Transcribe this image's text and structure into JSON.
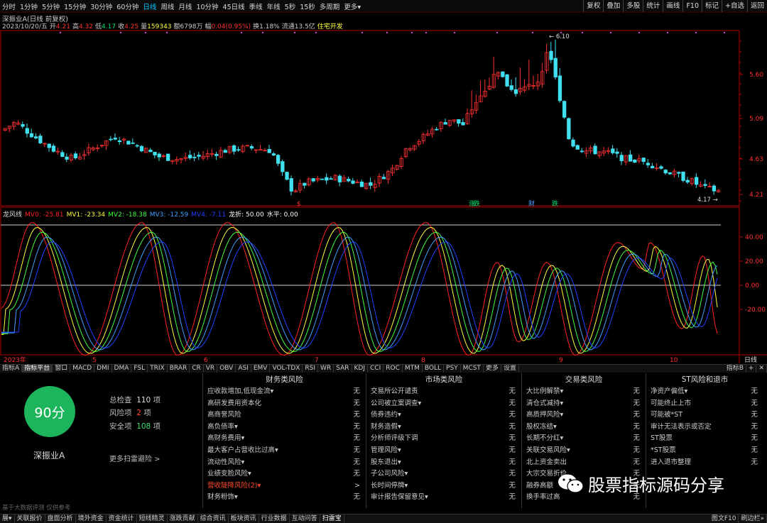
{
  "toolbar": {
    "periods": [
      "分时",
      "1分钟",
      "5分钟",
      "15分钟",
      "30分钟",
      "60分钟",
      "日线",
      "周线",
      "月线",
      "10分钟",
      "45日线",
      "季线",
      "年线",
      "5秒",
      "15秒",
      "多周期",
      "更多▾"
    ],
    "tools": [
      "复权",
      "叠加",
      "多股",
      "统计",
      "画线",
      "F10",
      "标记",
      "+自选",
      "返回"
    ]
  },
  "stock": {
    "title": "深振业A(日线 前复权)",
    "date": "2023/10/20/五",
    "open_label": "开",
    "open": "4.21",
    "high_label": "高",
    "high": "4.32",
    "low_label": "低",
    "low": "4.17",
    "close_label": "收",
    "close": "4.25",
    "volume_label": "量",
    "volume": "159343",
    "amount_label": "额",
    "amount": "6798万",
    "change_label": "幅",
    "change": "0.04(0.95%)",
    "turnover_label": "换",
    "turnover": "1.18%",
    "float_label": "流通",
    "float": "13.5亿",
    "sector": "住宅开发"
  },
  "price_axis": [
    "5.60",
    "5.09",
    "4.63",
    "4.21"
  ],
  "price_marks": {
    "high": "6.10",
    "low": "4.17"
  },
  "event_tags": [
    {
      "text": "$",
      "color": "#ff3030"
    },
    {
      "text": "涨",
      "color": "#00e070"
    },
    {
      "text": "跌",
      "color": "#00e070"
    },
    {
      "text": "财",
      "color": "#4aa0ff"
    },
    {
      "text": "跌",
      "color": "#00e070"
    }
  ],
  "indicator": {
    "name": "龙风线",
    "legend": [
      {
        "text": "MV0: -25.81",
        "color": "#ff2020"
      },
      {
        "text": "MV1: -23.34",
        "color": "#ffff40"
      },
      {
        "text": "MV2: -18.38",
        "color": "#40ff40"
      },
      {
        "text": "MV3: -12.59",
        "color": "#40a0ff"
      },
      {
        "text": "MV4: -7.11",
        "color": "#2040ff"
      },
      {
        "text": "龙折: 50.00",
        "color": "#ffffff"
      },
      {
        "text": "水平: 0.00",
        "color": "#ffffff"
      }
    ],
    "axis": [
      "40.00",
      "20.00",
      "0.00",
      "-20.00"
    ],
    "level": 50,
    "zero": 0
  },
  "time_axis": [
    "2023年",
    "5",
    "6",
    "7",
    "8",
    "9",
    "10"
  ],
  "time_axis_right": "日线",
  "indicator_tabs": [
    "指标A",
    "指标平台",
    "窗口",
    "MACD",
    "DMI",
    "DMA",
    "FSL",
    "TRIX",
    "BRAR",
    "CR",
    "VR",
    "OBV",
    "ASI",
    "EMV",
    "VOL-TDX",
    "RSI",
    "WR",
    "SAR",
    "KDJ",
    "CCI",
    "ROC",
    "MTM",
    "BOLL",
    "PSY",
    "MCST",
    "更多",
    "设置"
  ],
  "indicator_tabs_right": [
    "指标B",
    "+",
    "✕"
  ],
  "risk": {
    "score": "90分",
    "stock_name": "深振业A",
    "total_label": "总检查",
    "total": "110",
    "risk_label": "风险项",
    "risk_count": "2",
    "safe_label": "安全项",
    "safe_count": "108",
    "unit": "项",
    "more": "更多扫雷避险 >",
    "disclaimer": "基于大数据评测 仅供参考",
    "columns": [
      {
        "title": "财务类风险",
        "items": [
          {
            "label": "应收款增加,低现金流▾",
            "value": "无"
          },
          {
            "label": "高研发费用资本化",
            "value": "无"
          },
          {
            "label": "高商誉风险",
            "value": "无"
          },
          {
            "label": "高负债率▾",
            "value": "无"
          },
          {
            "label": "高财务费用▾",
            "value": "无"
          },
          {
            "label": "最大客户占营收比过高▾",
            "value": "无"
          },
          {
            "label": "流动性风险▾",
            "value": "无"
          },
          {
            "label": "业绩变脸风险▾",
            "value": "无"
          },
          {
            "label": "营收陡降风险(2)▾",
            "value": ">",
            "red": true
          },
          {
            "label": "财务粉饰▾",
            "value": "无"
          }
        ]
      },
      {
        "title": "市场类风险",
        "items": [
          {
            "label": "交易所公开谴责",
            "value": "无"
          },
          {
            "label": "公司被立案调查▾",
            "value": "无"
          },
          {
            "label": "债券违约▾",
            "value": "无"
          },
          {
            "label": "财务造假▾",
            "value": "无"
          },
          {
            "label": "分析师评级下调",
            "value": "无"
          },
          {
            "label": "管理风险▾",
            "value": "无"
          },
          {
            "label": "股东退出▾",
            "value": "无"
          },
          {
            "label": "子公司风险▾",
            "value": "无"
          },
          {
            "label": "长时间停牌▾",
            "value": "无"
          },
          {
            "label": "审计报告保留意见▾",
            "value": "无"
          }
        ]
      },
      {
        "title": "交易类风险",
        "items": [
          {
            "label": "大比例解禁▾",
            "value": "无"
          },
          {
            "label": "清仓式减持▾",
            "value": "无"
          },
          {
            "label": "高质押风险▾",
            "value": "无"
          },
          {
            "label": "股权冻结▾",
            "value": "无"
          },
          {
            "label": "长期不分红▾",
            "value": "无"
          },
          {
            "label": "关联交易风险▾",
            "value": "无"
          },
          {
            "label": "北上资金卖出",
            "value": "无"
          },
          {
            "label": "大宗交易折价",
            "value": "无"
          },
          {
            "label": "融券高额",
            "value": "无"
          },
          {
            "label": "换手率过高",
            "value": "无"
          }
        ]
      },
      {
        "title": "ST风险和退市",
        "items": [
          {
            "label": "净资产偏低▾",
            "value": "无"
          },
          {
            "label": "可能终止上市",
            "value": "无"
          },
          {
            "label": "可能被*ST",
            "value": "无"
          },
          {
            "label": "审计无法表示或否定",
            "value": "无"
          },
          {
            "label": "ST股票",
            "value": "无"
          },
          {
            "label": "*ST股票",
            "value": "无"
          },
          {
            "label": "进入退市整理",
            "value": "无"
          }
        ]
      }
    ]
  },
  "bottom_tabs": [
    "展▾",
    "关联报价",
    "盘面分析",
    "境外资金",
    "资金统计",
    "短线精灵",
    "涨跌贡献",
    "综合资讯",
    "板块资讯",
    "行业数据",
    "互动问答",
    "扫雷宝"
  ],
  "bottom_right": [
    "图文F10",
    "刷边栏»"
  ],
  "watermark": "股票指标源码分享",
  "colors": {
    "up": "#ff3030",
    "down": "#40e0f0",
    "axis_red": "#b00000",
    "score_green": "#1db55c"
  }
}
